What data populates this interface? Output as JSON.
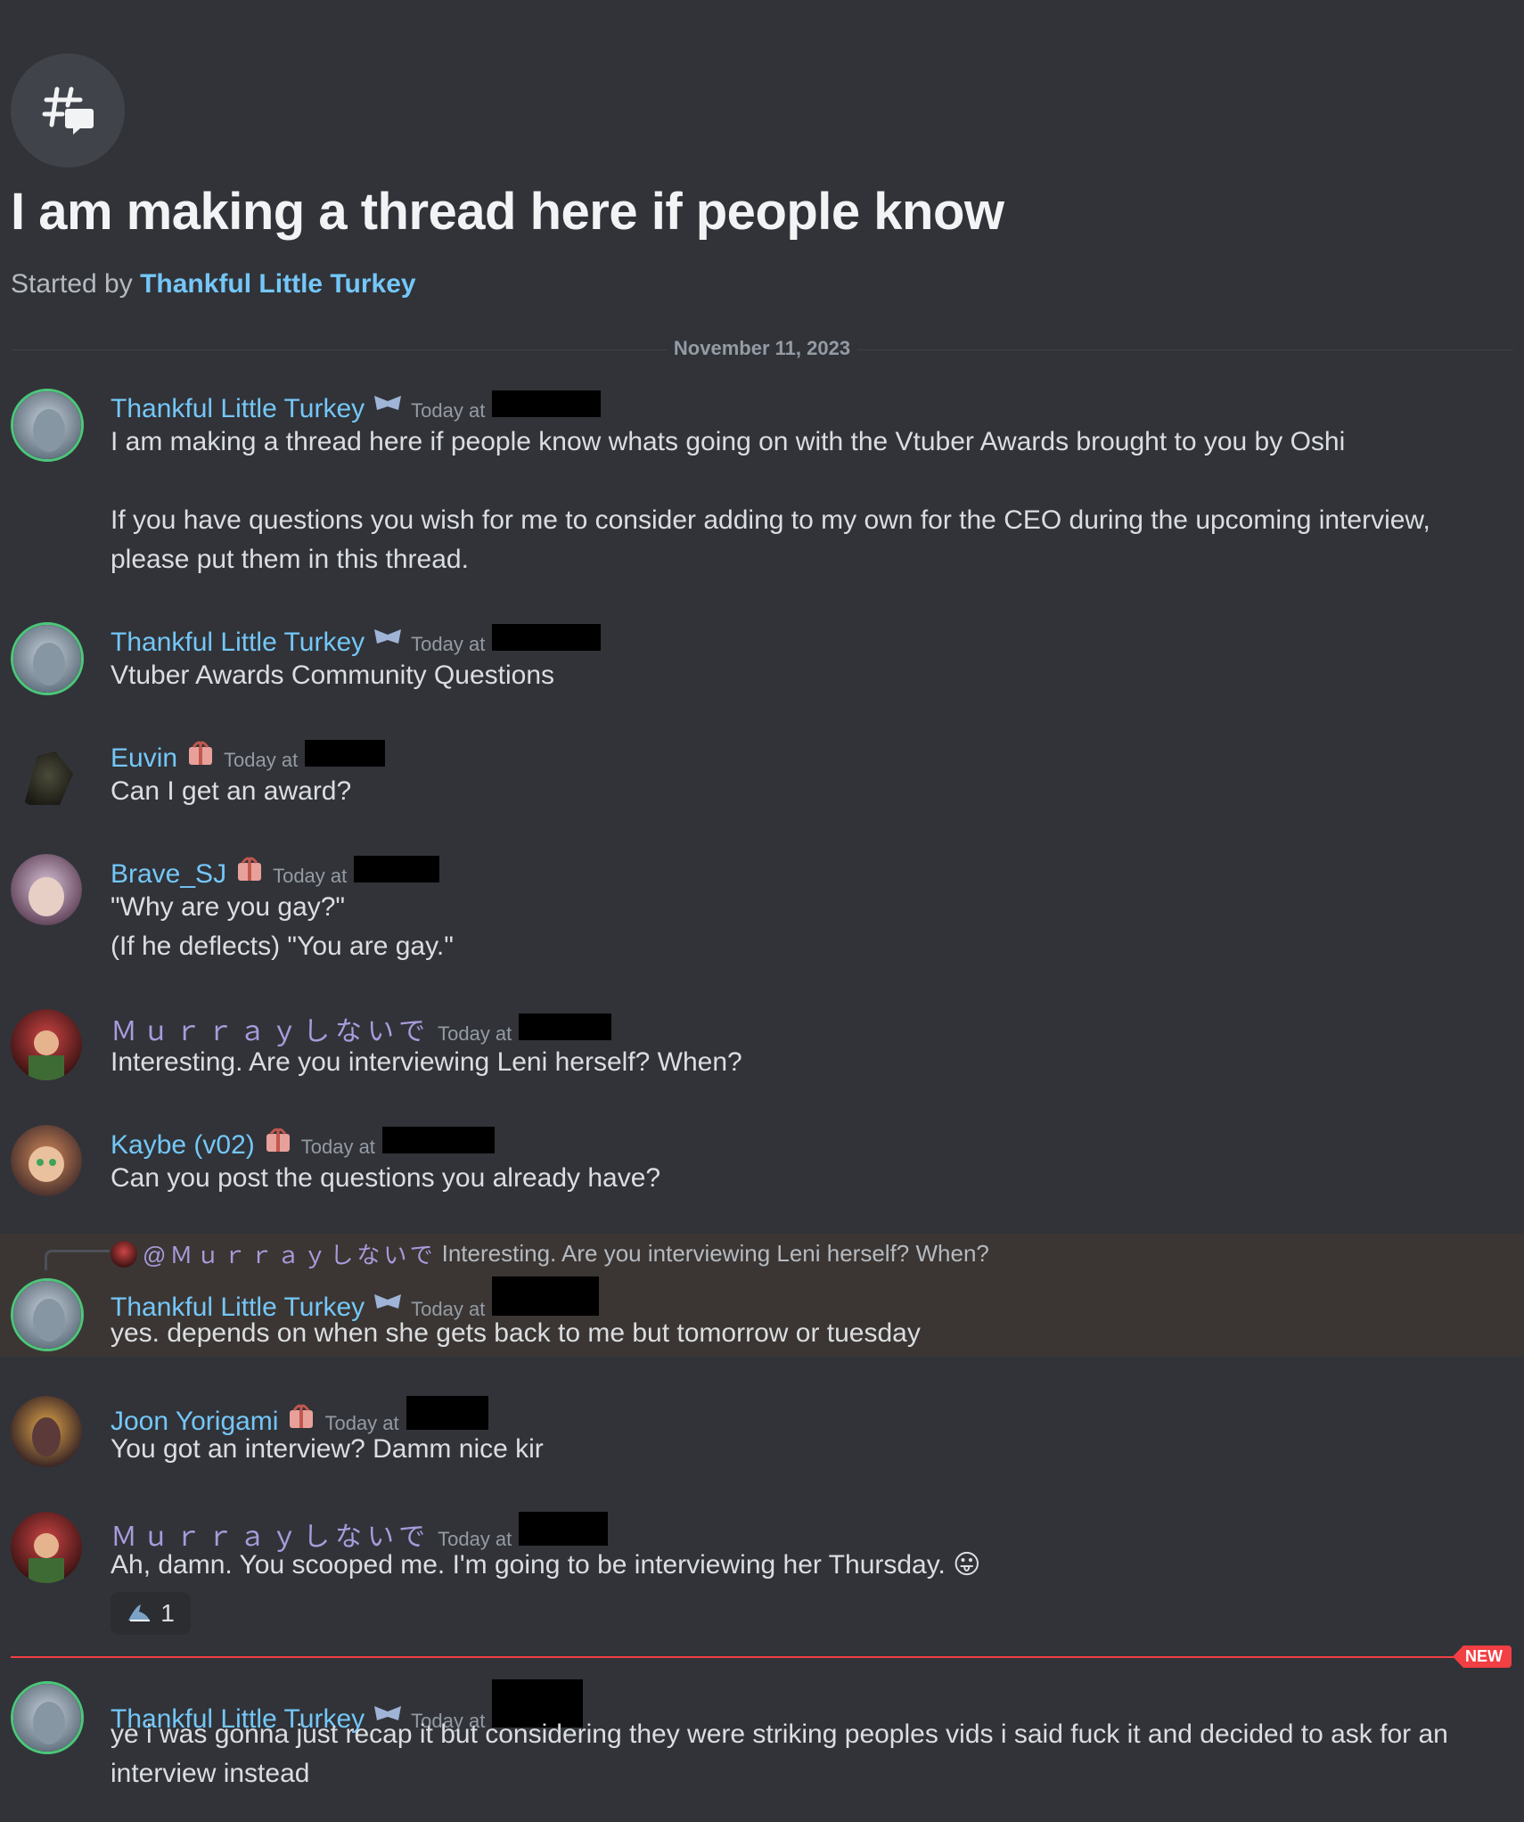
{
  "thread": {
    "icon": "thread-hash-icon",
    "title": "I am making a thread here if people know",
    "started_prefix": "Started by",
    "started_author": "Thankful Little Turkey"
  },
  "date_divider": "November 11, 2023",
  "timestamp_prefix": "Today at",
  "new_badge": "NEW",
  "colors": {
    "background": "#313338",
    "username_blue": "#74c7f8",
    "username_purple": "#a89bdc",
    "new_red": "#f23f43"
  },
  "messages": [
    {
      "author": "Thankful Little Turkey",
      "badge": "mask-badge-icon",
      "lines": [
        "I am making a thread here if people know whats going on with the Vtuber Awards brought to you by Oshi",
        "",
        "If you have questions you wish for me to consider adding to my own for the CEO during the upcoming interview, please put them in this thread."
      ]
    },
    {
      "author": "Thankful Little Turkey",
      "badge": "mask-badge-icon",
      "lines": [
        "Vtuber Awards Community Questions"
      ]
    },
    {
      "author": "Euvin",
      "badge": "gift-badge-icon",
      "lines": [
        "Can I get an award?"
      ]
    },
    {
      "author": "Brave_SJ",
      "badge": "gift-badge-icon",
      "lines": [
        "\"Why are you gay?\"",
        "(If he deflects) \"You are gay.\""
      ]
    },
    {
      "author": "Ｍｕｒｒａｙしないで",
      "badge": "",
      "lines": [
        "Interesting. Are you interviewing Leni herself? When?"
      ]
    },
    {
      "author": "Kaybe (v02)",
      "badge": "gift-badge-icon",
      "lines": [
        "Can you post the questions you already have?"
      ]
    },
    {
      "author": "Thankful Little Turkey",
      "badge": "mask-badge-icon",
      "reply_to": {
        "mention": "@Ｍｕｒｒａｙしないで",
        "text": "Interesting. Are you interviewing Leni herself? When?"
      },
      "lines": [
        "yes. depends on when she gets back to me but tomorrow or tuesday"
      ]
    },
    {
      "author": "Joon Yorigami",
      "badge": "gift-badge-icon",
      "lines": [
        "You got an interview? Damm nice kir"
      ]
    },
    {
      "author": "Ｍｕｒｒａｙしないで",
      "badge": "",
      "lines": [
        "Ah, damn. You scooped me. I'm going to be interviewing her Thursday. 😛"
      ],
      "reaction": {
        "icon": "shark-emoji-icon",
        "count": "1"
      }
    },
    {
      "author": "Thankful Little Turkey",
      "badge": "mask-badge-icon",
      "lines": [
        "ye i was gonna just recap it but considering they were striking peoples vids i said fuck it and decided to ask for an interview instead"
      ]
    }
  ]
}
